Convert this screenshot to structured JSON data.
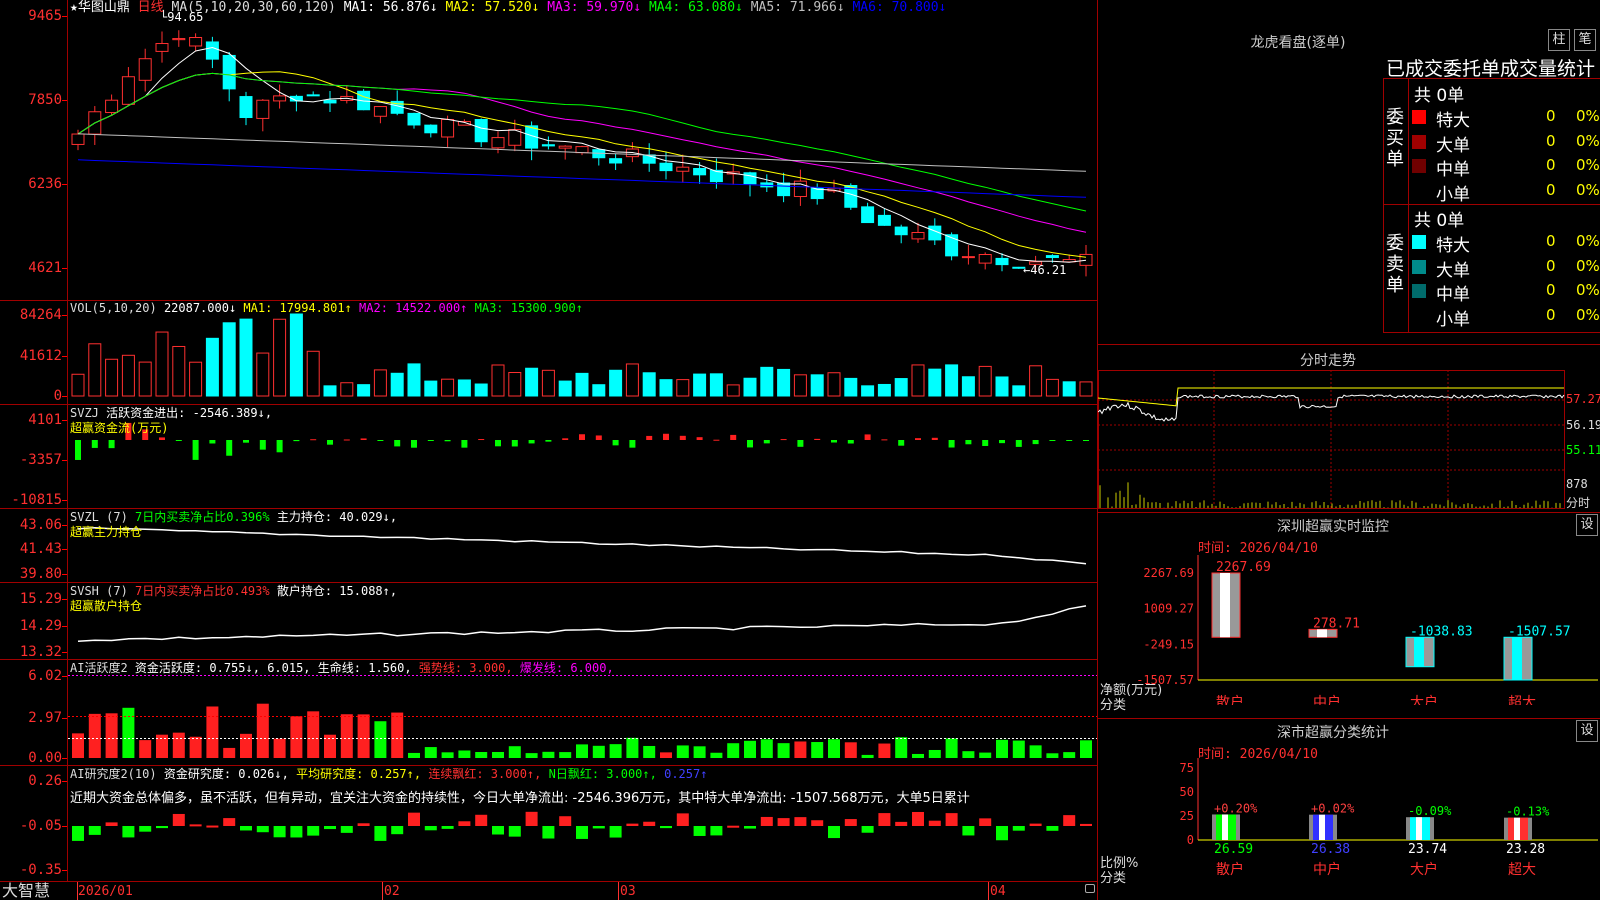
{
  "header": {
    "star": "★",
    "stock_name": "华图山鼎",
    "period": "日线",
    "ma_text": "MA(5,10,20,30,60,120)",
    "ma": [
      {
        "label": "MA1: 56.876↓",
        "color": "#ffffff"
      },
      {
        "label": "MA2: 57.520↓",
        "color": "#ffff00"
      },
      {
        "label": "MA3: 59.970↓",
        "color": "#ff00ff"
      },
      {
        "label": "MA4: 63.080↓",
        "color": "#00ff00"
      },
      {
        "label": "MA5: 71.966↓",
        "color": "#c0c0c0"
      },
      {
        "label": "MA6: 70.800↓",
        "color": "#0000ff"
      }
    ]
  },
  "price_axis": [
    "9465",
    "7850",
    "6236",
    "4621"
  ],
  "price_marks": {
    "high": "94.65",
    "low": "46.21"
  },
  "vol": {
    "axis": [
      "84264",
      "41612",
      "0"
    ],
    "title": "VOL(5,10,20)",
    "value": "22087.000↓",
    "ma": [
      {
        "label": "MA1: 17994.801↑",
        "color": "#ffff00"
      },
      {
        "label": "MA2: 14522.000↑",
        "color": "#ff00ff"
      },
      {
        "label": "MA3: 15300.900↑",
        "color": "#00ff00"
      }
    ]
  },
  "svzj": {
    "axis": [
      "4101",
      "-3357",
      "-10815"
    ],
    "title": "SVZJ",
    "text1": "活跃资金进出: -2546.389↓,",
    "text2": "超赢资金流(万元)"
  },
  "svzl": {
    "axis": [
      "43.06",
      "41.43",
      "39.80"
    ],
    "title": "SVZL (7)",
    "text1": "7日内买卖净占比0.396%",
    "text2": "主力持仓: 40.029↓,",
    "text3": "超赢主力持仓"
  },
  "svsh": {
    "axis": [
      "15.29",
      "14.29",
      "13.32"
    ],
    "title": "SVSH (7)",
    "text1": "7日内买卖净占比0.493%",
    "text2": "散户持仓: 15.088↑,",
    "text3": "超赢散户持仓"
  },
  "ai1": {
    "axis": [
      "6.02",
      "2.97",
      "0.00"
    ],
    "title": "AI活跃度2",
    "t1": "资金活跃度: 0.755↓,",
    "t2": "6.015,",
    "t3": "生命线: 1.560,",
    "t4": "强势线: 3.000,",
    "t5": "爆发线: 6.000,"
  },
  "ai2": {
    "axis": [
      "0.26",
      "-0.05",
      "-0.35"
    ],
    "title": "AI研究度2(10)",
    "t1": "资金研究度: 0.026↓,",
    "t2": "平均研究度: 0.257↑,",
    "t3": "连续飘红: 3.000↑,",
    "t4": "N日飘红: 3.000↑,",
    "t5": "0.257↑",
    "comment": "近期大资金总体偏多，虽不活跃，但有异动，宜关注大资金的持续性，今日大单净流出: -2546.396万元，其中特大单净流出: -1507.568万元，大单5日累计"
  },
  "x_axis": {
    "labels": [
      "2026/01",
      "02",
      "03",
      "04"
    ],
    "brand": "大智慧"
  },
  "right": {
    "lhkp_title": "龙虎看盘(逐单)",
    "btn_zhu": "柱",
    "btn_bi": "笔",
    "stats_title": "已成交委托单成交量统计",
    "buy_label": "委买单",
    "sell_label": "委卖单",
    "buy_total": "共 0单",
    "sell_total": "共 0单",
    "buy_rows": [
      {
        "name": "特大",
        "count": "0",
        "pct": "0%",
        "color": "#ff0000"
      },
      {
        "name": "大单",
        "count": "0",
        "pct": "0%",
        "color": "#a00000"
      },
      {
        "name": "中单",
        "count": "0",
        "pct": "0%",
        "color": "#700000"
      },
      {
        "name": "小单",
        "count": "0",
        "pct": "0%",
        "color": ""
      }
    ],
    "sell_rows": [
      {
        "name": "特大",
        "count": "0",
        "pct": "0%",
        "color": "#00ffff"
      },
      {
        "name": "大单",
        "count": "0",
        "pct": "0%",
        "color": "#008b8b"
      },
      {
        "name": "中单",
        "count": "0",
        "pct": "0%",
        "color": "#006b6b"
      },
      {
        "name": "小单",
        "count": "0",
        "pct": "0%",
        "color": ""
      }
    ],
    "fenshi_title": "分时走势",
    "fenshi_axis": [
      "57.27",
      "56.19",
      "55.11"
    ],
    "fenshi_vol": "878",
    "fenshi_unit": "分时",
    "sz_monitor": {
      "title": "深圳超赢实时监控",
      "btn": "设",
      "time": "时间: 2026/04/10",
      "axis": [
        "2267.69",
        "1009.27",
        "-249.15",
        "-1507.57"
      ],
      "unit1": "净额(万元)",
      "unit2": "分类"
    },
    "sz_stats": {
      "title": "深市超赢分类统计",
      "btn": "设",
      "time": "时间: 2026/04/10",
      "axis": [
        "75",
        "50",
        "25",
        "0"
      ],
      "unit1": "比例%",
      "unit2": "分类"
    }
  },
  "chart_data": [
    {
      "type": "bar",
      "title": "深圳超赢实时监控",
      "xlabel": "分类",
      "ylabel": "净额(万元)",
      "categories": [
        "散户",
        "中户",
        "大户",
        "超大"
      ],
      "values": [
        2267.69,
        278.71,
        -1038.83,
        -1507.57
      ],
      "value_labels": [
        "2267.69",
        "278.71",
        "-1038.83",
        "-1507.57"
      ],
      "colors": [
        "#ffffff",
        "#ffffff",
        "#00ffff",
        "#00ffff"
      ],
      "ylim": [
        -1507.57,
        2267.69
      ]
    },
    {
      "type": "bar",
      "title": "深市超赢分类统计",
      "xlabel": "分类",
      "ylabel": "比例%",
      "categories": [
        "散户",
        "中户",
        "大户",
        "超大"
      ],
      "values": [
        26.59,
        26.38,
        23.74,
        23.28
      ],
      "value_labels": [
        "26.59",
        "26.38",
        "23.74",
        "23.28"
      ],
      "change_labels": [
        "+0.20%",
        "+0.02%",
        "-0.09%",
        "-0.13%"
      ],
      "change_colors": [
        "#ff4040",
        "#ff4040",
        "#00ff00",
        "#00ff00"
      ],
      "label_colors": [
        "#00ff00",
        "#4040ff",
        "#ffffff",
        "#ffffff"
      ],
      "colors": [
        "#00ff00",
        "#3030ff",
        "#00ffff",
        "#ff3030"
      ],
      "ylim": [
        0,
        75
      ]
    }
  ]
}
